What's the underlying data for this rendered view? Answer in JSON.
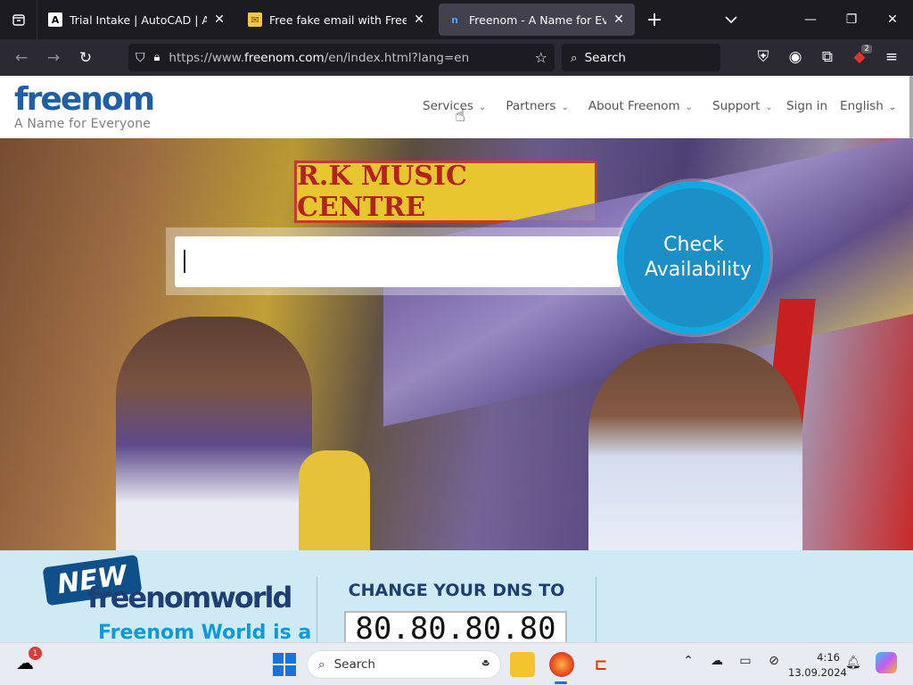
{
  "browser": {
    "tabs": [
      {
        "title": "Trial Intake | AutoCAD | Autode",
        "favicon": "autodesk-icon",
        "active": false
      },
      {
        "title": "Free fake email with Freenom",
        "favicon": "email-icon",
        "active": false
      },
      {
        "title": "Freenom - A Name for Everyone",
        "favicon": "freenom-icon",
        "active": true
      }
    ],
    "new_tab": "+",
    "url_prefix": "https://www.",
    "url_host": "freenom.com",
    "url_path": "/en/index.html?lang=en",
    "search_placeholder": "Search",
    "extension_badge": "2"
  },
  "site": {
    "logo_word": "freenom",
    "logo_tagline": "A Name for Everyone",
    "nav": [
      {
        "label": "Services"
      },
      {
        "label": "Partners"
      },
      {
        "label": "About Freenom"
      },
      {
        "label": "Support"
      }
    ],
    "sign_in": "Sign in",
    "language": "English",
    "hero_sign_text": "R.K MUSIC CENTRE",
    "domain_input_value": "",
    "check_button": "Check Availability",
    "promo": {
      "new_label": "NEW",
      "freenomworld_logo": "freenomworld",
      "freenomworld_text": "Freenom World is a",
      "dns_title": "CHANGE YOUR DNS TO",
      "dns_value": "80.80.80.80"
    }
  },
  "taskbar": {
    "weather_notification": "1",
    "search_label": "Search",
    "time": "4:16",
    "date": "13.09.2024"
  },
  "colors": {
    "brand_blue": "#1f5fa8",
    "check_button": "#1b8fc6",
    "promo_bg": "#cfeaf4"
  }
}
